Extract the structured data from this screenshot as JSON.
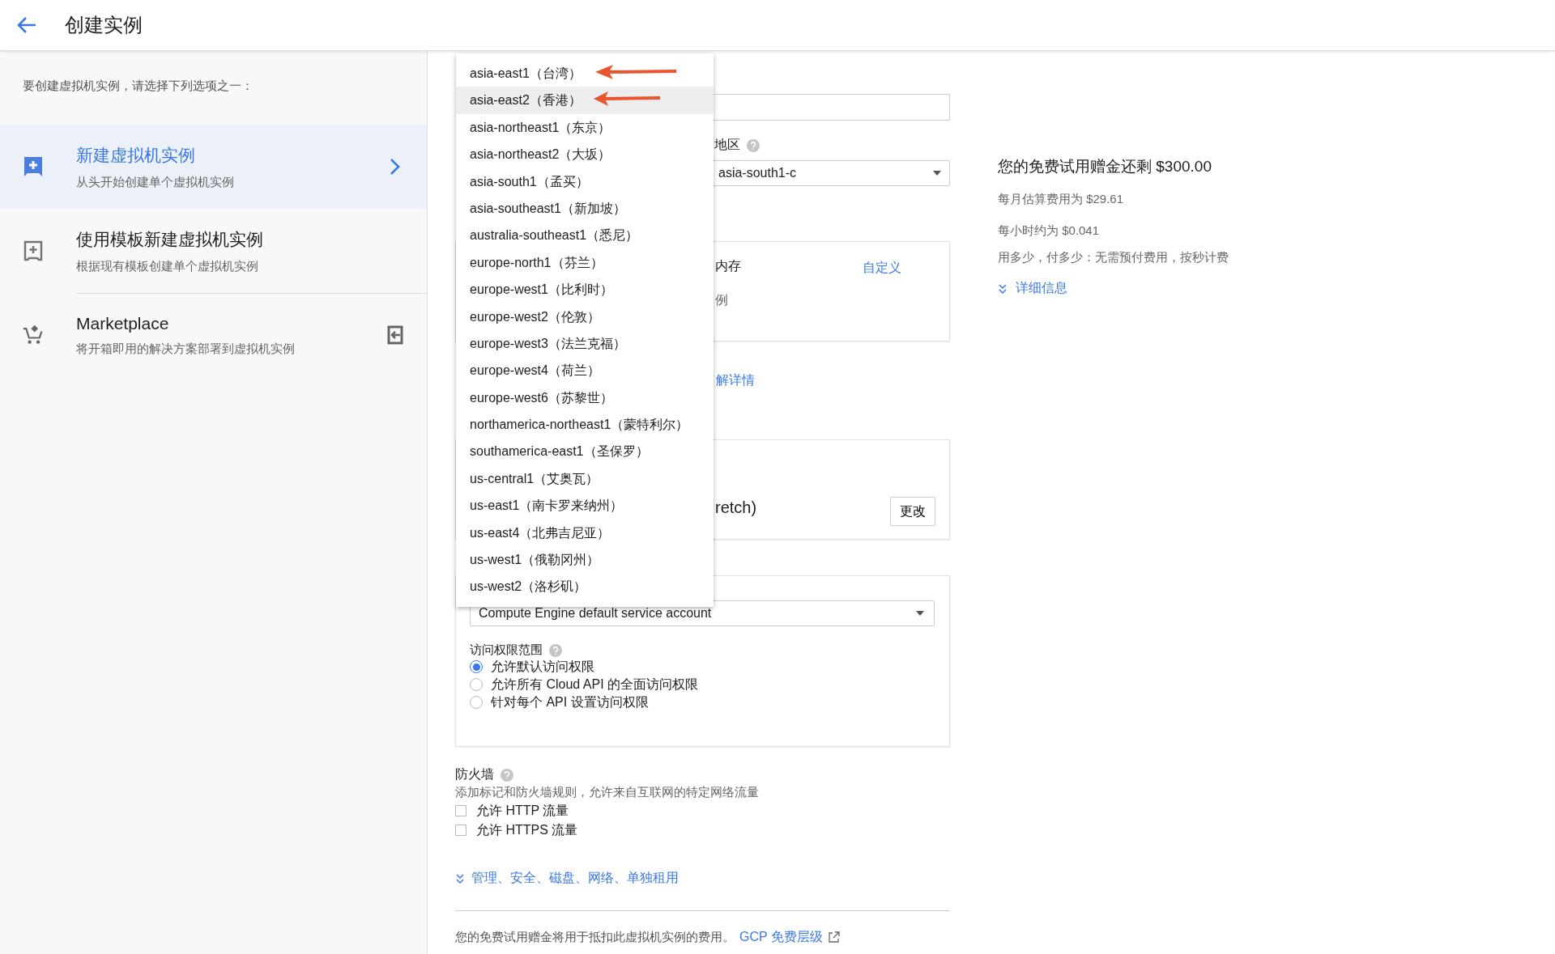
{
  "header": {
    "title": "创建实例"
  },
  "sidebar": {
    "intro": "要创建虚拟机实例，请选择下列选项之一：",
    "items": [
      {
        "kind": "new",
        "title": "新建虚拟机实例",
        "subtitle": "从头开始创建单个虚拟机实例",
        "selected": true
      },
      {
        "kind": "template",
        "title": "使用模板新建虚拟机实例",
        "subtitle": "根据现有模板创建单个虚拟机实例",
        "selected": false
      },
      {
        "kind": "marketplace",
        "title": "Marketplace",
        "subtitle": "将开箱即用的解决方案部署到虚拟机实例",
        "selected": false
      }
    ]
  },
  "region_dropdown": {
    "items": [
      {
        "label": "asia-east1（台湾）",
        "highlighted": false,
        "marked": true
      },
      {
        "label": "asia-east2（香港）",
        "highlighted": true,
        "marked": true
      },
      {
        "label": "asia-northeast1（东京）",
        "highlighted": false,
        "marked": false
      },
      {
        "label": "asia-northeast2（大坂）",
        "highlighted": false,
        "marked": false
      },
      {
        "label": "asia-south1（孟买）",
        "highlighted": false,
        "marked": false
      },
      {
        "label": "asia-southeast1（新加坡）",
        "highlighted": false,
        "marked": false
      },
      {
        "label": "australia-southeast1（悉尼）",
        "highlighted": false,
        "marked": false
      },
      {
        "label": "europe-north1（芬兰）",
        "highlighted": false,
        "marked": false
      },
      {
        "label": "europe-west1（比利时）",
        "highlighted": false,
        "marked": false
      },
      {
        "label": "europe-west2（伦敦）",
        "highlighted": false,
        "marked": false
      },
      {
        "label": "europe-west3（法兰克福）",
        "highlighted": false,
        "marked": false
      },
      {
        "label": "europe-west4（荷兰）",
        "highlighted": false,
        "marked": false
      },
      {
        "label": "europe-west6（苏黎世）",
        "highlighted": false,
        "marked": false
      },
      {
        "label": "northamerica-northeast1（蒙特利尔）",
        "highlighted": false,
        "marked": false
      },
      {
        "label": "southamerica-east1（圣保罗）",
        "highlighted": false,
        "marked": false
      },
      {
        "label": "us-central1（艾奥瓦）",
        "highlighted": false,
        "marked": false
      },
      {
        "label": "us-east1（南卡罗来纳州）",
        "highlighted": false,
        "marked": false
      },
      {
        "label": "us-east4（北弗吉尼亚）",
        "highlighted": false,
        "marked": false
      },
      {
        "label": "us-west1（俄勒冈州）",
        "highlighted": false,
        "marked": false
      },
      {
        "label": "us-west2（洛杉矶）",
        "highlighted": false,
        "marked": false
      }
    ]
  },
  "form": {
    "zone_label": "地区",
    "zone_value": "asia-south1-c",
    "machine_fragment": "内存",
    "customize_link": "自定义",
    "instance_fragment": "例",
    "details_link": "解详情",
    "boot_disk_fragment": "retch)",
    "change_button": "更改",
    "service_account_value": "Compute Engine default service account",
    "access_scopes": {
      "label": "访问权限范围",
      "options": [
        {
          "label": "允许默认访问权限",
          "selected": true
        },
        {
          "label": "允许所有 Cloud API 的全面访问权限",
          "selected": false
        },
        {
          "label": "针对每个 API 设置访问权限",
          "selected": false
        }
      ]
    },
    "firewall": {
      "label": "防火墙",
      "description": "添加标记和防火墙规则，允许来自互联网的特定网络流量",
      "options": [
        {
          "label": "允许 HTTP 流量",
          "checked": false
        },
        {
          "label": "允许 HTTPS 流量",
          "checked": false
        }
      ]
    },
    "advanced_link": "管理、安全、磁盘、网络、单独租用",
    "footer": {
      "text": "您的免费试用赠金将用于抵扣此虚拟机实例的费用。",
      "link": "GCP 免费层级"
    }
  },
  "pricing": {
    "title": "您的免费试用赠金还剩 $300.00",
    "monthly": "每月估算费用为 $29.61",
    "hourly": "每小时约为 $0.041",
    "note": "用多少，付多少：无需预付费用，按秒计费",
    "details_link": "详细信息"
  }
}
